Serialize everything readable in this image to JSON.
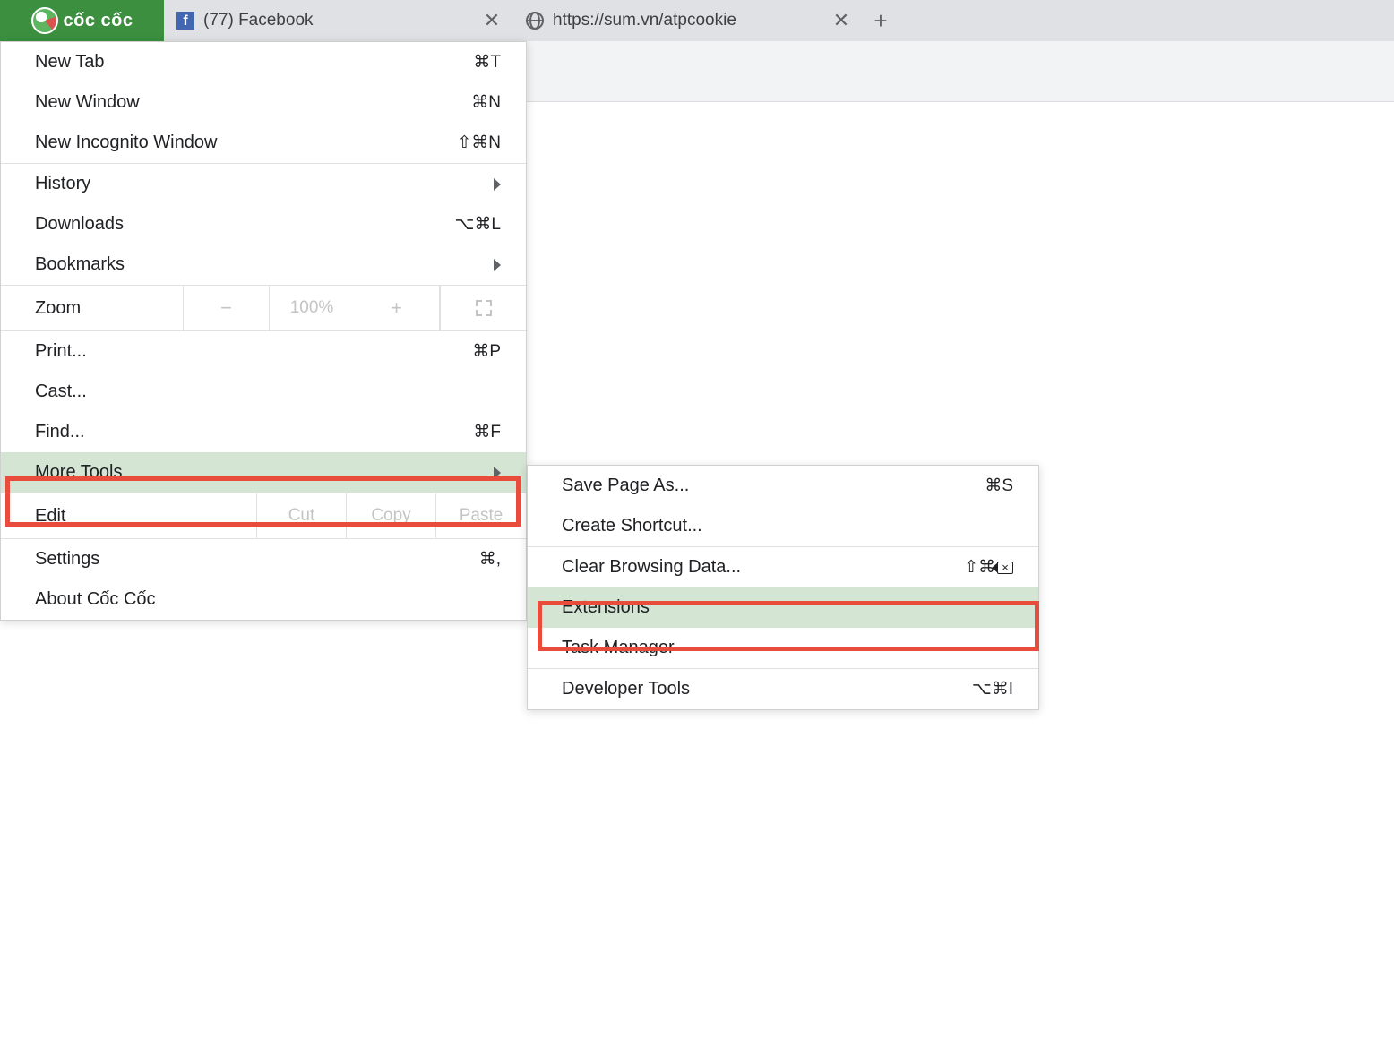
{
  "brand": {
    "name": "cốc cốc"
  },
  "tabs": [
    {
      "title": "(77) Facebook",
      "favicon": "facebook"
    },
    {
      "title": "https://sum.vn/atpcookie",
      "favicon": "globe"
    }
  ],
  "main_menu": {
    "new_tab": {
      "label": "New Tab",
      "shortcut": "⌘T"
    },
    "new_window": {
      "label": "New Window",
      "shortcut": "⌘N"
    },
    "new_incognito": {
      "label": "New Incognito Window",
      "shortcut": "⇧⌘N"
    },
    "history": {
      "label": "History"
    },
    "downloads": {
      "label": "Downloads",
      "shortcut": "⌥⌘L"
    },
    "bookmarks": {
      "label": "Bookmarks"
    },
    "zoom": {
      "label": "Zoom",
      "level": "100%"
    },
    "print": {
      "label": "Print...",
      "shortcut": "⌘P"
    },
    "cast": {
      "label": "Cast..."
    },
    "find": {
      "label": "Find...",
      "shortcut": "⌘F"
    },
    "more_tools": {
      "label": "More Tools"
    },
    "edit": {
      "label": "Edit",
      "cut": "Cut",
      "copy": "Copy",
      "paste": "Paste"
    },
    "settings": {
      "label": "Settings",
      "shortcut": "⌘,"
    },
    "about": {
      "label": "About Cốc Cốc"
    }
  },
  "sub_menu": {
    "save_page": {
      "label": "Save Page As...",
      "shortcut": "⌘S"
    },
    "create_shortcut": {
      "label": "Create Shortcut..."
    },
    "clear_browsing": {
      "label": "Clear Browsing Data...",
      "shortcut": "⇧⌘"
    },
    "extensions": {
      "label": "Extensions"
    },
    "task_manager": {
      "label": "Task Manager"
    },
    "developer_tools": {
      "label": "Developer Tools",
      "shortcut": "⌥⌘I"
    }
  }
}
